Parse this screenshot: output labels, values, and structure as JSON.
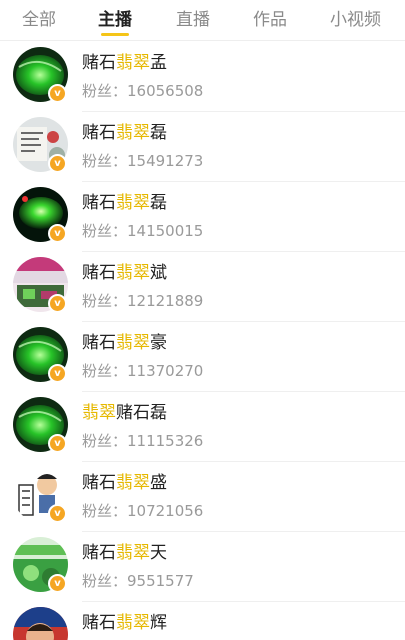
{
  "tabs": [
    {
      "label": "全部",
      "active": false
    },
    {
      "label": "主播",
      "active": true
    },
    {
      "label": "直播",
      "active": false
    },
    {
      "label": "作品",
      "active": false
    },
    {
      "label": "小视频",
      "active": false
    }
  ],
  "colors": {
    "accent": "#f5c518",
    "highlight_text": "#e6b800",
    "badge": "#f5a623",
    "secondary_text": "#9a9a9a"
  },
  "badge_label": "v",
  "fans_prefix": "粉丝：",
  "anchors": [
    {
      "name_pre": "赌石",
      "name_hl": "翡翠",
      "name_post": "孟",
      "fans": "16056508",
      "avatar": "green-jade-icon"
    },
    {
      "name_pre": "赌石",
      "name_hl": "翡翠",
      "name_post": "磊",
      "fans": "15491273",
      "avatar": "text-sign-icon"
    },
    {
      "name_pre": "赌石",
      "name_hl": "翡翠",
      "name_post": "磊",
      "fans": "14150015",
      "avatar": "glowing-jade-icon"
    },
    {
      "name_pre": "赌石",
      "name_hl": "翡翠",
      "name_post": "斌",
      "fans": "12121889",
      "avatar": "colorful-banner-icon"
    },
    {
      "name_pre": "赌石",
      "name_hl": "翡翠",
      "name_post": "豪",
      "fans": "11370270",
      "avatar": "green-jade-icon"
    },
    {
      "name_pre": "",
      "name_hl": "翡翠",
      "name_post": "赌石磊",
      "fans": "11115326",
      "avatar": "green-jade-icon"
    },
    {
      "name_pre": "赌石",
      "name_hl": "翡翠",
      "name_post": "盛",
      "fans": "10721056",
      "avatar": "cartoon-character-icon"
    },
    {
      "name_pre": "赌石",
      "name_hl": "翡翠",
      "name_post": "天",
      "fans": "9551577",
      "avatar": "green-banner-icon"
    },
    {
      "name_pre": "赌石",
      "name_hl": "翡翠",
      "name_post": "辉",
      "fans": "",
      "avatar": "portrait-icon"
    }
  ]
}
